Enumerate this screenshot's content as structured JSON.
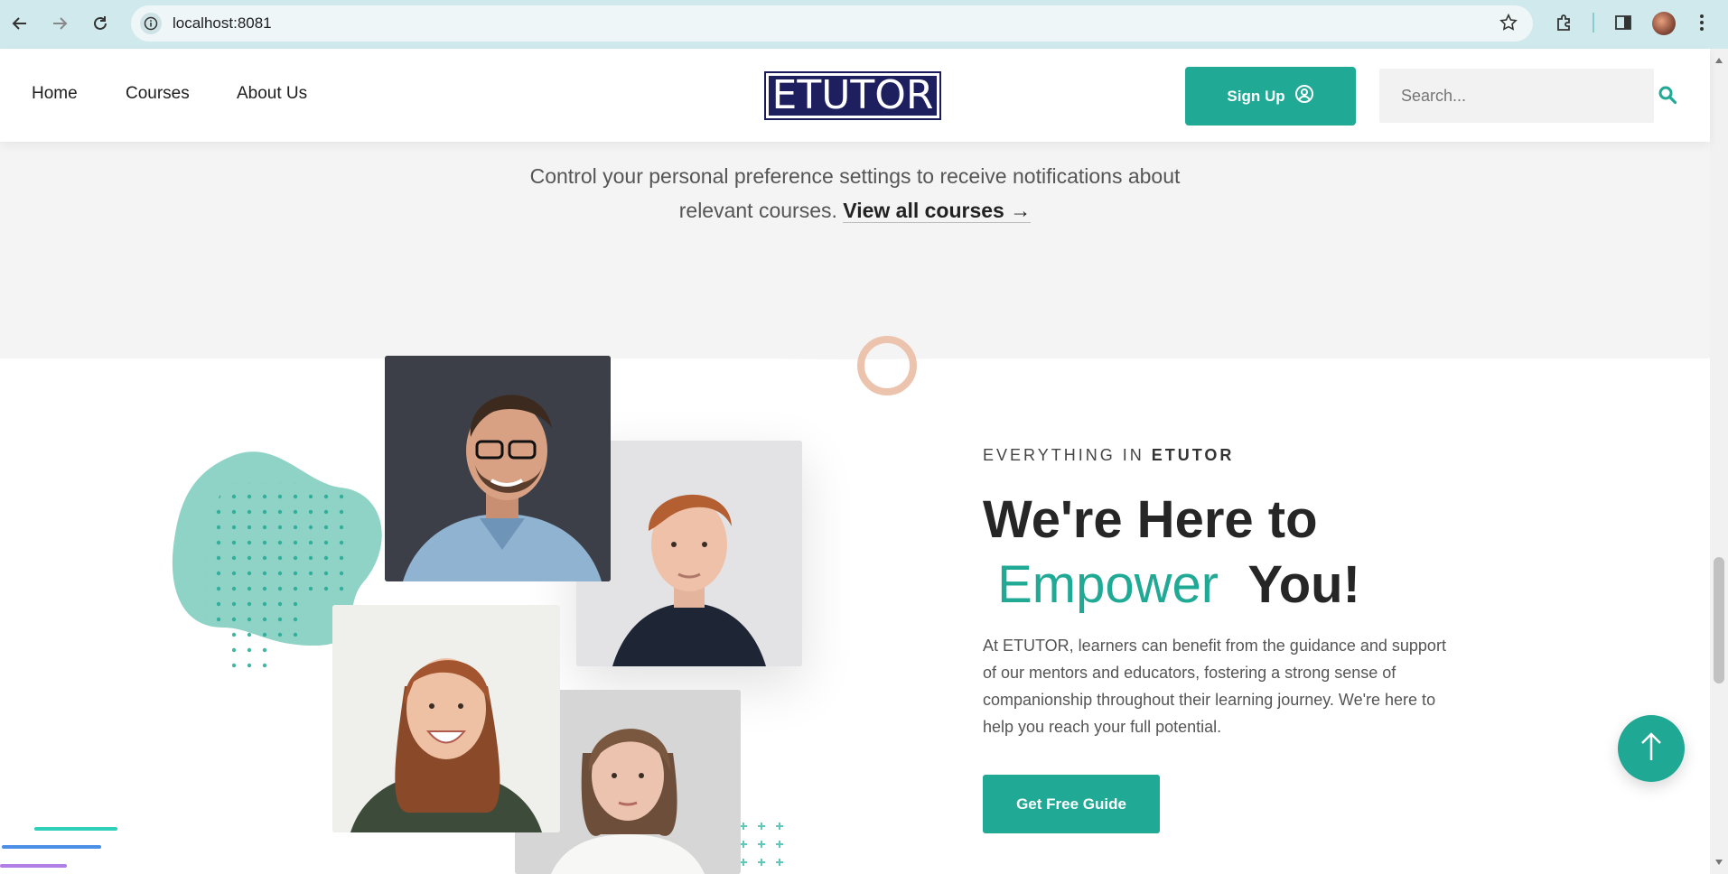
{
  "browser": {
    "url": "localhost:8081"
  },
  "header": {
    "nav": [
      "Home",
      "Courses",
      "About Us"
    ],
    "logo_text": "ETUTOR",
    "signup_label": "Sign Up",
    "search_placeholder": "Search..."
  },
  "intro": {
    "line1": "Control your personal preference settings to receive notifications about",
    "line2": "relevant courses.",
    "link": "View all courses",
    "link_arrow": "→"
  },
  "about": {
    "eyebrow_prefix": "EVERYTHING IN",
    "eyebrow_brand": "ETUTOR",
    "heading_line1": "We're Here to",
    "heading_accent": "Empower",
    "heading_end": "You!",
    "paragraph": "At ETUTOR, learners can benefit from the guidance and support of our mentors and educators, fostering a strong sense of companionship throughout their learning journey. We're here to help you reach your full potential.",
    "cta_label": "Get Free Guide"
  },
  "colors": {
    "accent": "#20a995",
    "logo_bg": "#1e1f5e",
    "blob": "#8fd3c6",
    "ring": "#ecc4ad"
  },
  "icons": [
    "back-icon",
    "forward-icon",
    "reload-icon",
    "info-icon",
    "star-icon",
    "extensions-icon",
    "sidepanel-icon",
    "menu-icon",
    "user-circle-icon",
    "search-icon",
    "arrow-up-icon"
  ]
}
